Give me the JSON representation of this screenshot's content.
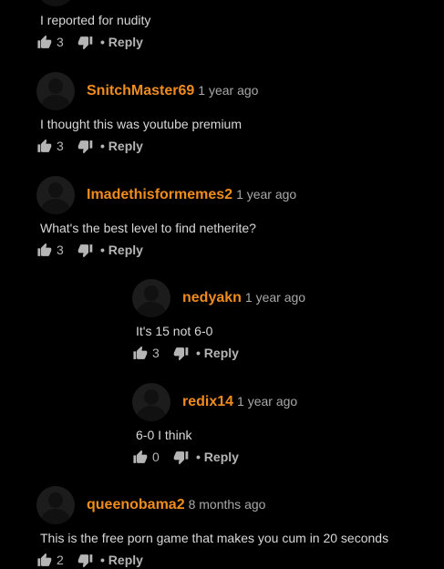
{
  "comments": [
    {
      "username": "",
      "time": "",
      "text": "I reported for nudity",
      "likes": "3",
      "reply_label": "• Reply"
    },
    {
      "username": "SnitchMaster69",
      "time": "1 year ago",
      "text": "I thought this was youtube premium",
      "likes": "3",
      "reply_label": "• Reply"
    },
    {
      "username": "Imadethisformemes2",
      "time": "1 year ago",
      "text": "What's the best level to find netherite?",
      "likes": "3",
      "reply_label": "• Reply"
    },
    {
      "username": "nedyakn",
      "time": "1 year ago",
      "text": "It's 15 not 6-0",
      "likes": "3",
      "reply_label": "• Reply"
    },
    {
      "username": "redix14",
      "time": "1 year ago",
      "text": "6-0 I think",
      "likes": "0",
      "reply_label": "• Reply"
    },
    {
      "username": "queenobama2",
      "time": "8 months ago",
      "text": "This is the free porn game that makes you cum in 20 seconds",
      "likes": "2",
      "reply_label": "• Reply"
    }
  ],
  "icons": {
    "like": "thumbs-up-icon",
    "dislike": "thumbs-down-icon",
    "avatar": "default-avatar-icon"
  },
  "colors": {
    "background": "#000000",
    "username": "#f08c1e",
    "text": "#d8d8d8",
    "meta": "#a8a8a8"
  }
}
